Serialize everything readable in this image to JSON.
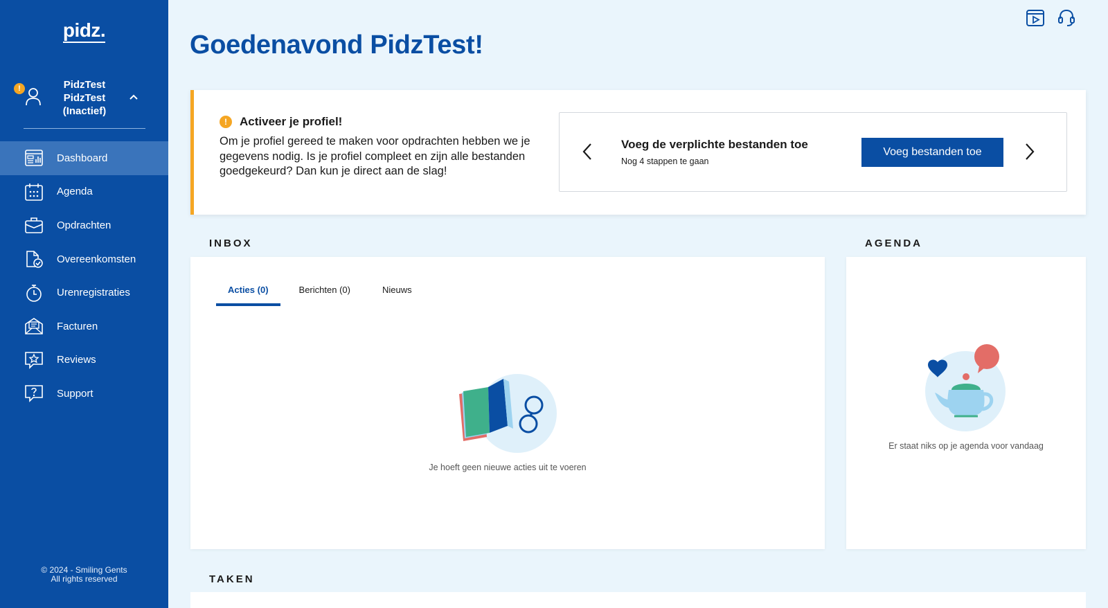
{
  "sidebar": {
    "logo": "pidz.",
    "user": {
      "warning_badge": "!",
      "name_line1": "PidzTest",
      "name_line2": "PidzTest",
      "status": "(Inactief)"
    },
    "items": [
      {
        "label": "Dashboard",
        "icon": "dashboard-icon",
        "active": true
      },
      {
        "label": "Agenda",
        "icon": "calendar-icon"
      },
      {
        "label": "Opdrachten",
        "icon": "briefcase-icon"
      },
      {
        "label": "Overeenkomsten",
        "icon": "contract-icon"
      },
      {
        "label": "Urenregistraties",
        "icon": "stopwatch-icon"
      },
      {
        "label": "Facturen",
        "icon": "invoice-icon"
      },
      {
        "label": "Reviews",
        "icon": "review-star-icon"
      },
      {
        "label": "Support",
        "icon": "support-question-icon"
      }
    ],
    "copyright_line1": "© 2024 - Smiling Gents",
    "copyright_line2": "All rights reserved"
  },
  "header": {
    "greeting": "Goedenavond PidzTest!",
    "icons": [
      "video-play-icon",
      "headset-icon"
    ]
  },
  "activate": {
    "title": "Activeer je profiel!",
    "text": "Om je profiel gereed te maken voor opdrachten hebben we je gegevens nodig. Is je profiel compleet en zijn alle bestanden goedgekeurd? Dan kun je direct aan de slag!",
    "step": {
      "title": "Voeg de verplichte bestanden toe",
      "subtitle": "Nog 4 stappen te gaan",
      "button": "Voeg bestanden toe"
    }
  },
  "inbox": {
    "title": "INBOX",
    "tabs": [
      {
        "label": "Acties (0)",
        "active": true
      },
      {
        "label": "Berichten (0)"
      },
      {
        "label": "Nieuws"
      }
    ],
    "empty_text": "Je hoeft geen nieuwe acties uit te voeren"
  },
  "agenda": {
    "title": "AGENDA",
    "empty_text": "Er staat niks op je agenda voor vandaag"
  },
  "taken": {
    "title": "TAKEN"
  },
  "colors": {
    "brand": "#0a4ea3",
    "warning": "#f5a623",
    "background": "#eaf5fc"
  }
}
